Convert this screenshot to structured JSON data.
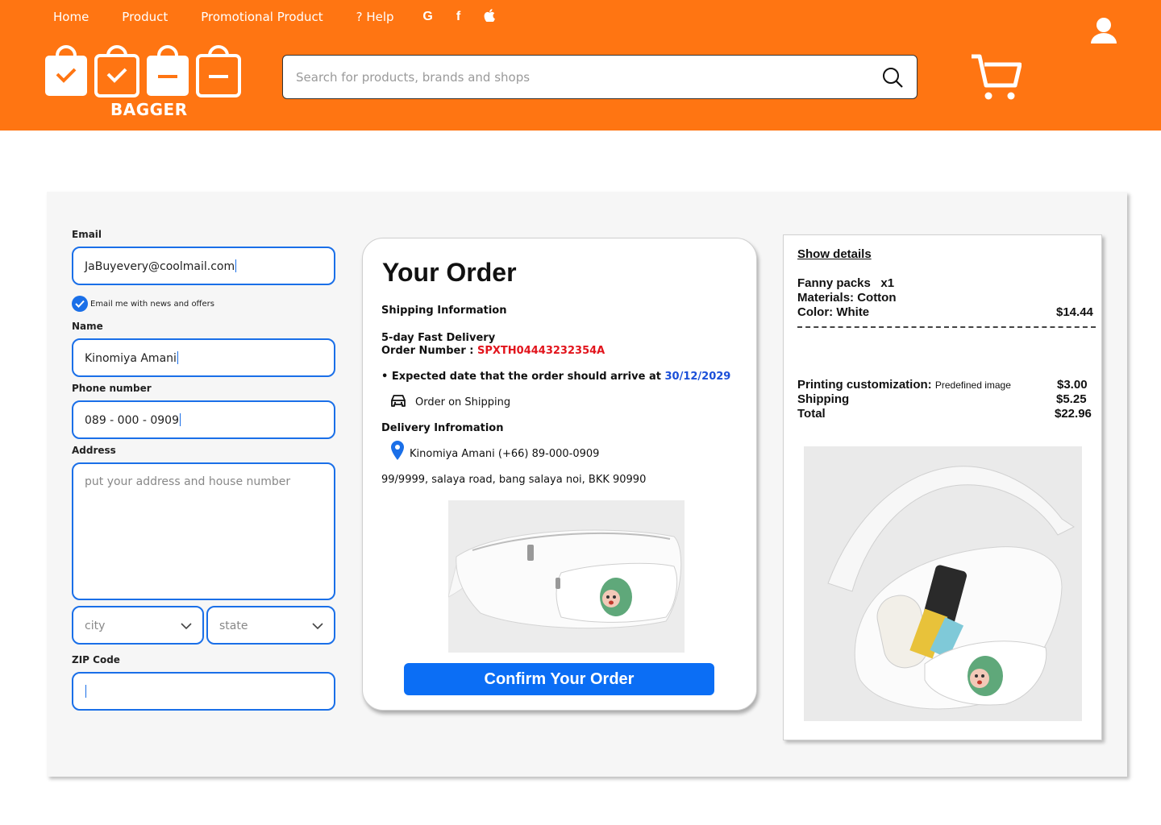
{
  "nav": {
    "links": [
      "Home",
      "Product",
      "Promotional Product",
      "? Help"
    ],
    "social_icons": [
      "google-icon",
      "facebook-icon",
      "apple-icon"
    ]
  },
  "brand": {
    "name": "BAGGER",
    "color": "#ff7512"
  },
  "search": {
    "placeholder": "Search for products, brands and shops"
  },
  "form": {
    "email_label": "Email",
    "email_value": "JaBuyevery@coolmail.com",
    "newsletter_label": "Email me with news and offers",
    "newsletter_checked": true,
    "name_label": "Name",
    "name_value": "Kinomiya Amani",
    "phone_label": "Phone number",
    "phone_value": "089 - 000 - 0909",
    "address_label": "Address",
    "address_placeholder": "put your address and house number",
    "city_placeholder": "city",
    "state_placeholder": "state",
    "zip_label": "ZIP Code",
    "zip_value": ""
  },
  "order": {
    "title": "Your Order",
    "shipping_heading": "Shipping Information",
    "delivery_type": "5-day Fast Delivery",
    "order_number_label": "Order Number : ",
    "order_number": "SPXTH04443232354A",
    "expected_label": "• Expected date that the order should arrive at ",
    "expected_date": "30/12/2029",
    "status": "Order on Shipping",
    "delivery_heading": "Delivery Infromation",
    "recipient": "Kinomiya Amani (+66) 89-000-0909",
    "address": "99/9999, salaya road, bang salaya noi, BKK 90990",
    "confirm_label": "Confirm Your Order"
  },
  "summary": {
    "show_details": "Show details",
    "product_name": "Fanny packs",
    "quantity": "x1",
    "material": "Materials: Cotton",
    "color": "Color: White",
    "product_price": "$14.44",
    "printing_label": "Printing customization:",
    "printing_option": "Predefined image",
    "printing_price": "$3.00",
    "shipping_label": "Shipping",
    "shipping_price": "$5.25",
    "total_label": "Total",
    "total_price": "$22.96"
  },
  "colors": {
    "accent_blue": "#1a6fe8",
    "button_blue": "#0b6ef5",
    "total_red": "#e2141c"
  }
}
